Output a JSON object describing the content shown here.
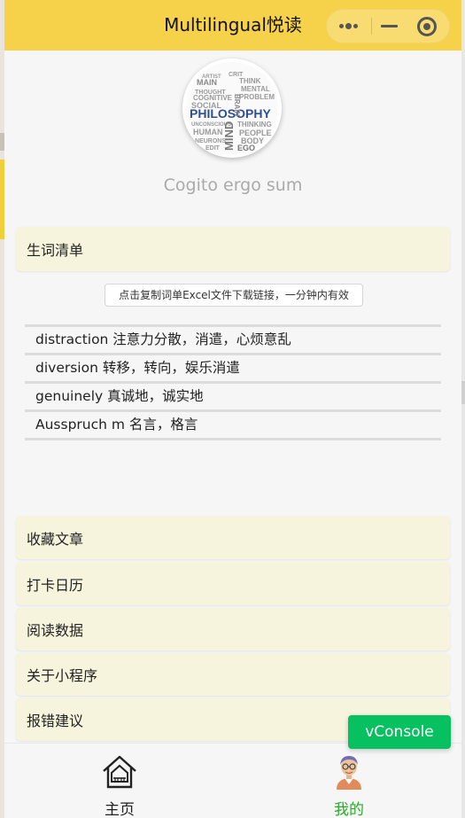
{
  "navbar": {
    "title": "Multilingual悦读",
    "capsule": {
      "more_icon": "more-dots-icon",
      "minimize_icon": "minimize-icon",
      "close_icon": "target-circle-icon"
    }
  },
  "profile": {
    "avatar_icon": "philosophy-word-cloud-avatar",
    "motto": "Cogito ergo sum"
  },
  "word_card": {
    "label": "生词清单"
  },
  "copy_button": {
    "label": "点击复制词单Excel文件下载链接，一分钟内有效"
  },
  "words": [
    "distraction 注意力分散，消遣，心烦意乱",
    "diversion 转移，转向，娱乐消遣",
    "genuinely 真诚地，诚实地",
    "Ausspruch m 名言，格言"
  ],
  "menu": [
    "收藏文章",
    "打卡日历",
    "阅读数据",
    "关于小程序",
    "报错建议"
  ],
  "tabbar": {
    "home": {
      "label": "主页",
      "icon": "home-icon",
      "active": false
    },
    "me": {
      "label": "我的",
      "icon": "user-avatar-icon",
      "active": true
    },
    "active_color": "#2aaa2a"
  },
  "vconsole": {
    "label": "vConsole"
  },
  "colors": {
    "navbar": "#f6d24a",
    "card": "#f6f4dc",
    "vconsole": "#07c160"
  }
}
